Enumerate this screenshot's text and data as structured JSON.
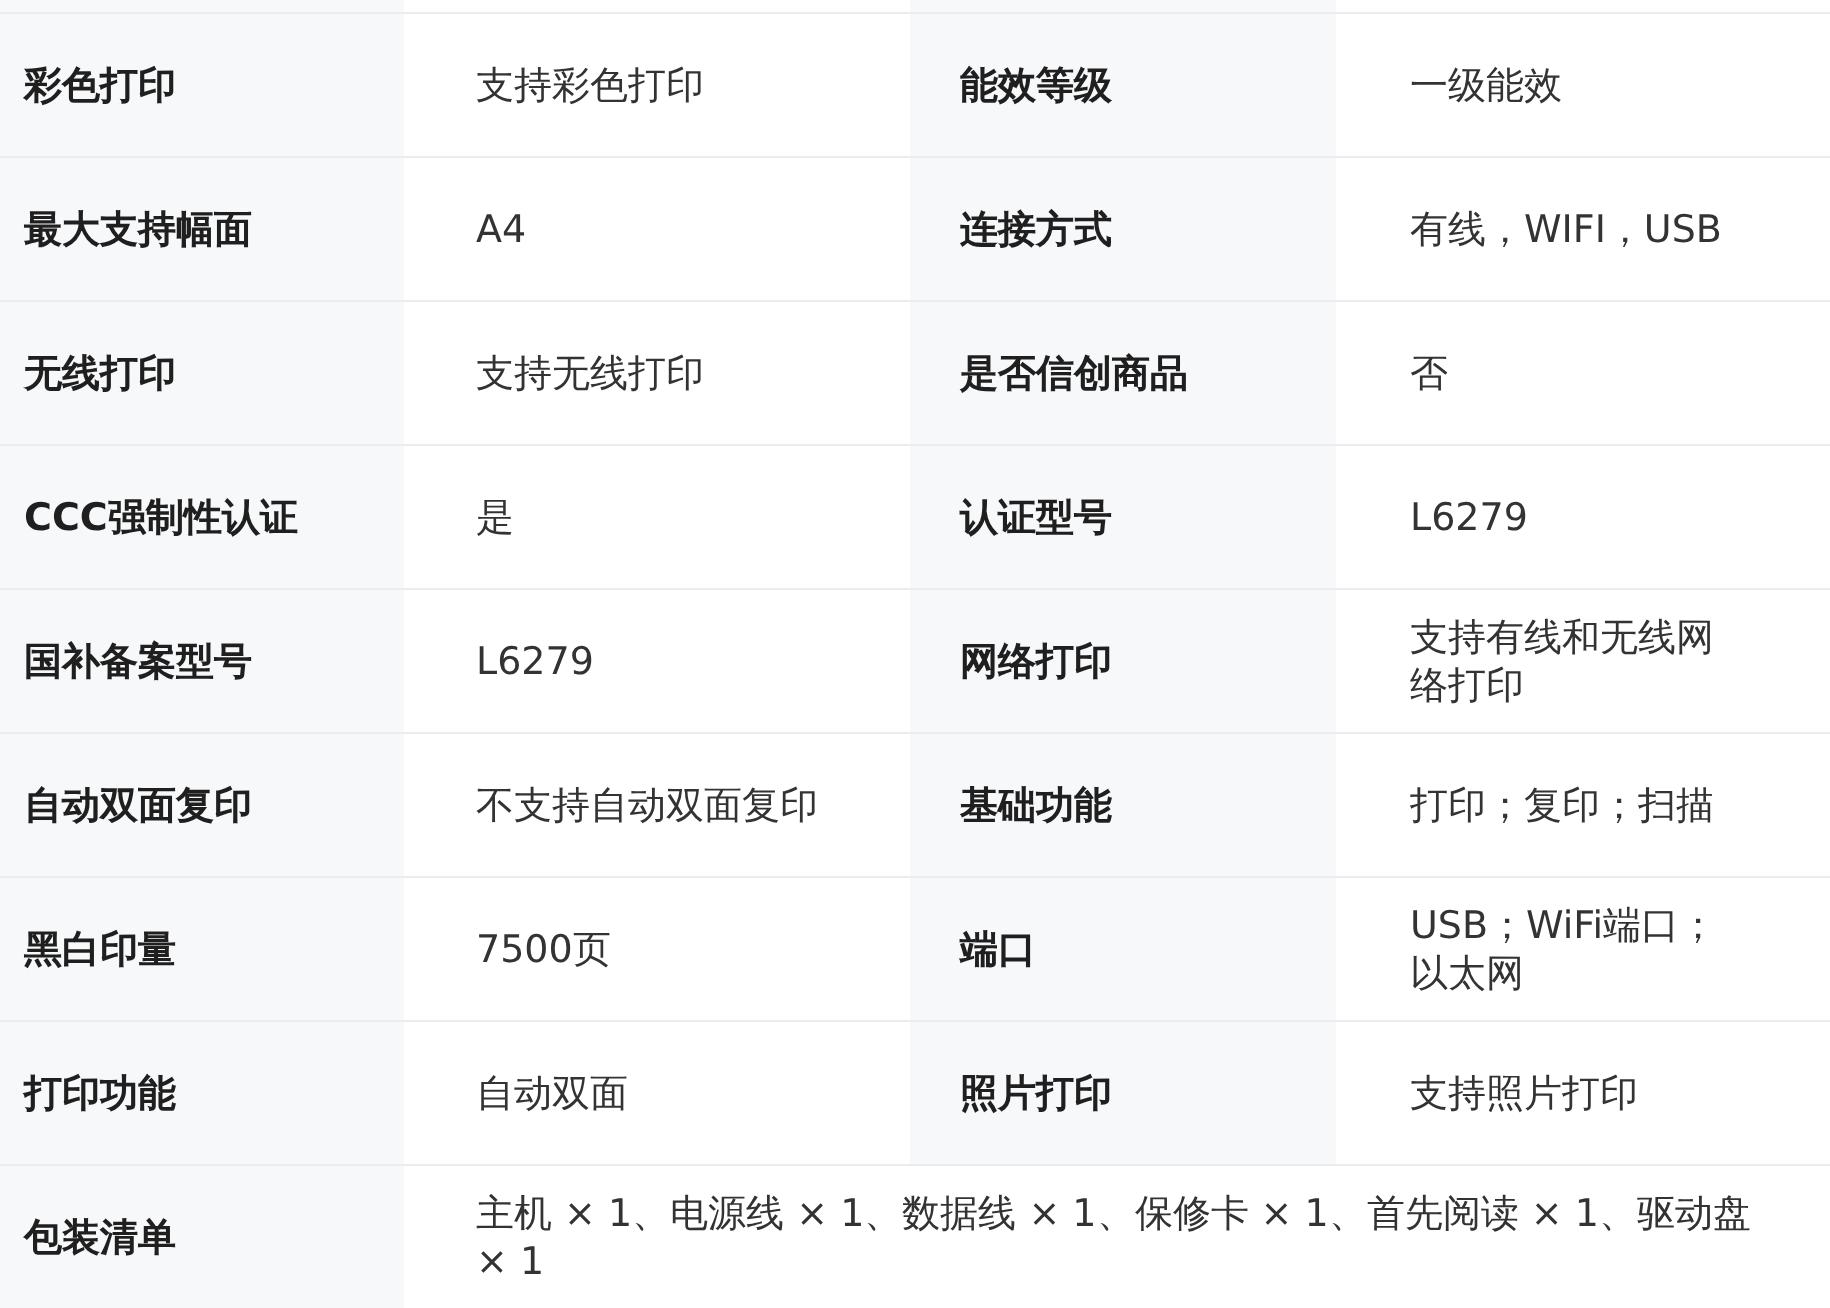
{
  "rows": [
    {
      "cells": [
        {
          "label": "彩色打印",
          "value": "支持彩色打印"
        },
        {
          "label": "能效等级",
          "value": "一级能效"
        }
      ]
    },
    {
      "cells": [
        {
          "label": "最大支持幅面",
          "value": "A4"
        },
        {
          "label": "连接方式",
          "value": "有线，WIFI，USB"
        }
      ]
    },
    {
      "cells": [
        {
          "label": "无线打印",
          "value": "支持无线打印"
        },
        {
          "label": "是否信创商品",
          "value": "否"
        }
      ]
    },
    {
      "cells": [
        {
          "label": "CCC强制性认证",
          "value": "是"
        },
        {
          "label": "认证型号",
          "value": "L6279"
        }
      ]
    },
    {
      "cells": [
        {
          "label": "国补备案型号",
          "value": "L6279"
        },
        {
          "label": "网络打印",
          "value": "支持有线和无线网络打印"
        }
      ]
    },
    {
      "cells": [
        {
          "label": "自动双面复印",
          "value": "不支持自动双面复印"
        },
        {
          "label": "基础功能",
          "value": "打印；复印；扫描"
        }
      ]
    },
    {
      "cells": [
        {
          "label": "黑白印量",
          "value": "7500页"
        },
        {
          "label": "端口",
          "value": "USB；WiFi端口；以太网"
        }
      ]
    },
    {
      "cells": [
        {
          "label": "打印功能",
          "value": "自动双面"
        },
        {
          "label": "照片打印",
          "value": "支持照片打印"
        }
      ]
    },
    {
      "cells": [
        {
          "label": "包装清单",
          "value": "主机 × 1、电源线 × 1、数据线 × 1、保修卡 × 1、首先阅读 × 1、驱动盘 × 1"
        }
      ]
    }
  ]
}
